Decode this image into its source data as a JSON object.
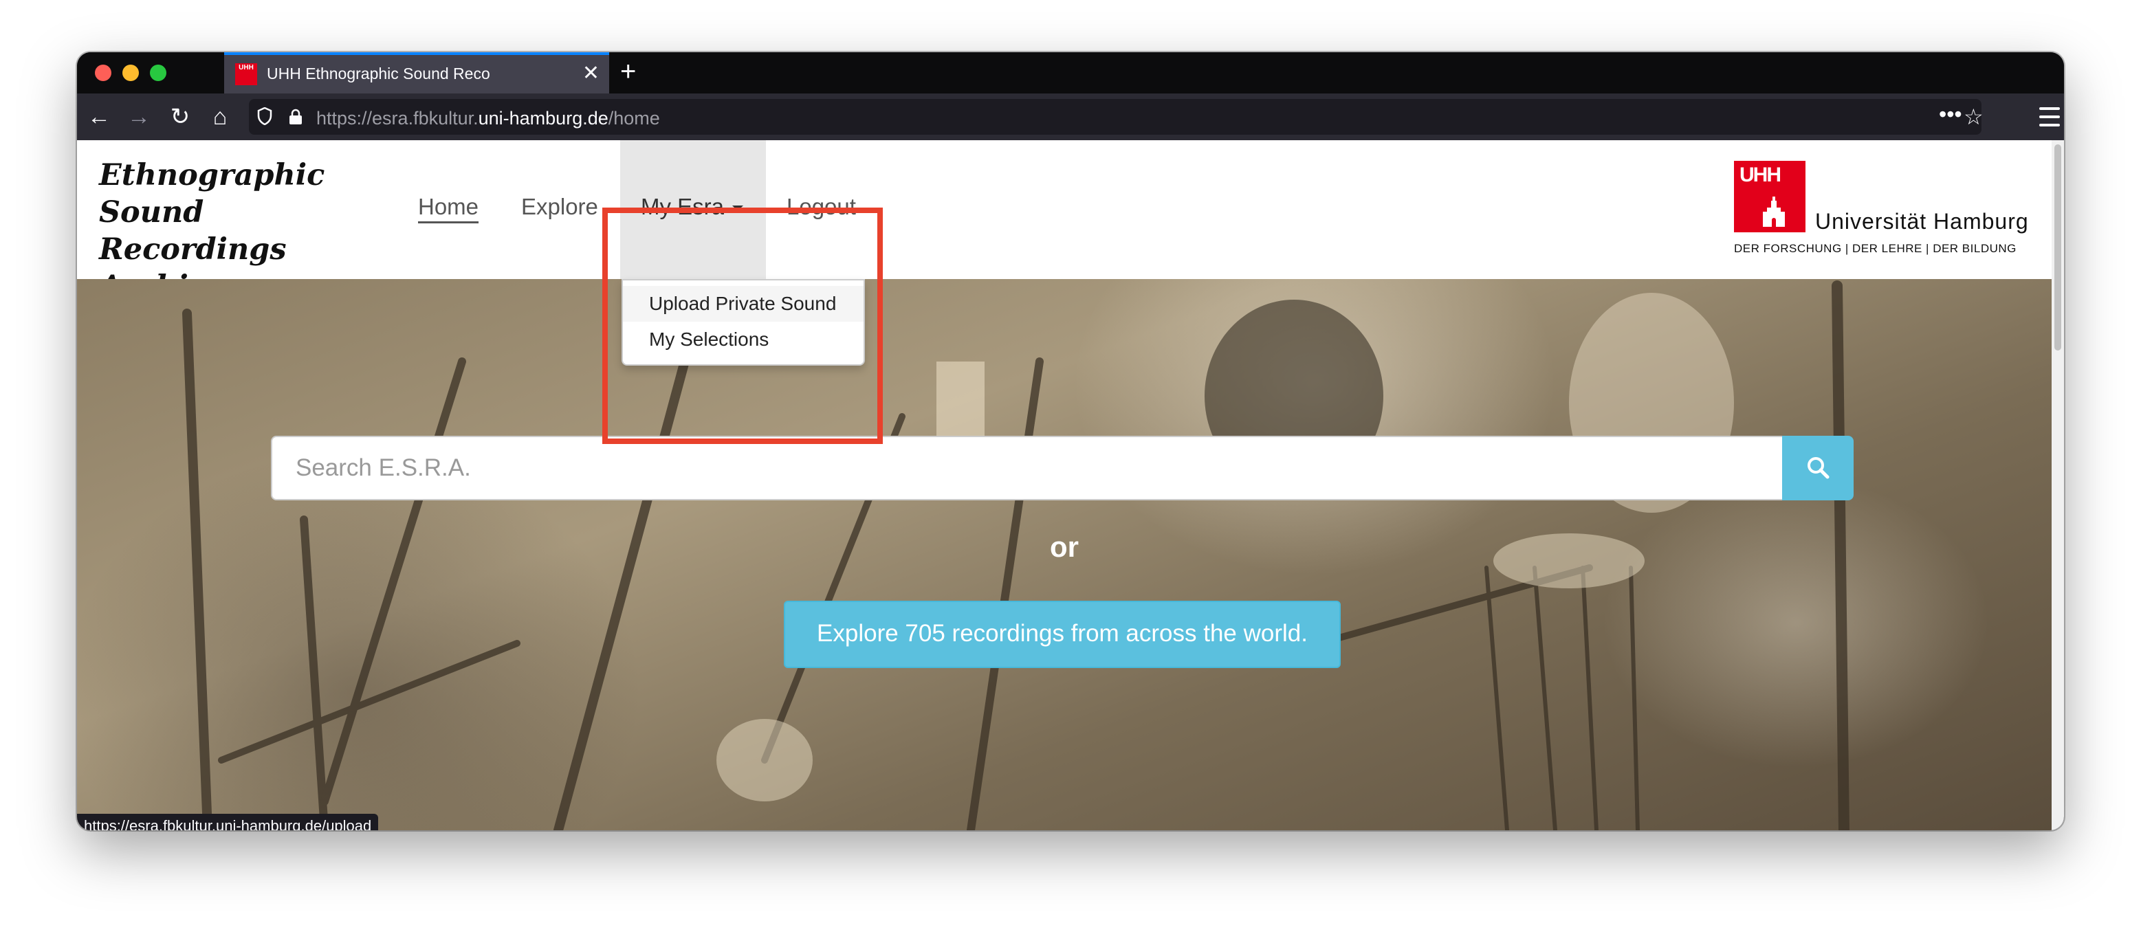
{
  "browser": {
    "tab_title": "UHH Ethnographic Sound Reco",
    "tab_favicon_text": "UHH",
    "url_prefix": "https://esra.fbkultur.",
    "url_host": "uni-hamburg.de",
    "url_path": "/home",
    "status_url": "https://esra.fbkultur.uni-hamburg.de/upload",
    "icons": [
      "back-icon",
      "forward-icon",
      "reload-icon",
      "home-icon",
      "shield-icon",
      "lock-icon",
      "more-icon",
      "bookmark-star-icon",
      "menu-icon",
      "close-icon",
      "plus-icon"
    ]
  },
  "site": {
    "brand_line1": "Ethnographic",
    "brand_line2": "Sound Recordings",
    "brand_line3": "Archive",
    "nav": {
      "home": "Home",
      "explore": "Explore",
      "my_esra": "My Esra",
      "logout": "Logout"
    },
    "dropdown": {
      "upload": "Upload Private Sound",
      "selections": "My Selections"
    },
    "logo": {
      "letters": "UHH",
      "name": "Universität Hamburg",
      "tagline": "DER FORSCHUNG  |  DER LEHRE  |  DER BILDUNG"
    }
  },
  "hero": {
    "search_placeholder": "Search E.S.R.A.",
    "or_text": "or",
    "explore_button": "Explore 705 recordings from across the world."
  },
  "colors": {
    "accent": "#5bc0de",
    "highlight": "#e8412c",
    "uhh_red": "#e2001a",
    "browser_dark": "#1c1b22"
  }
}
